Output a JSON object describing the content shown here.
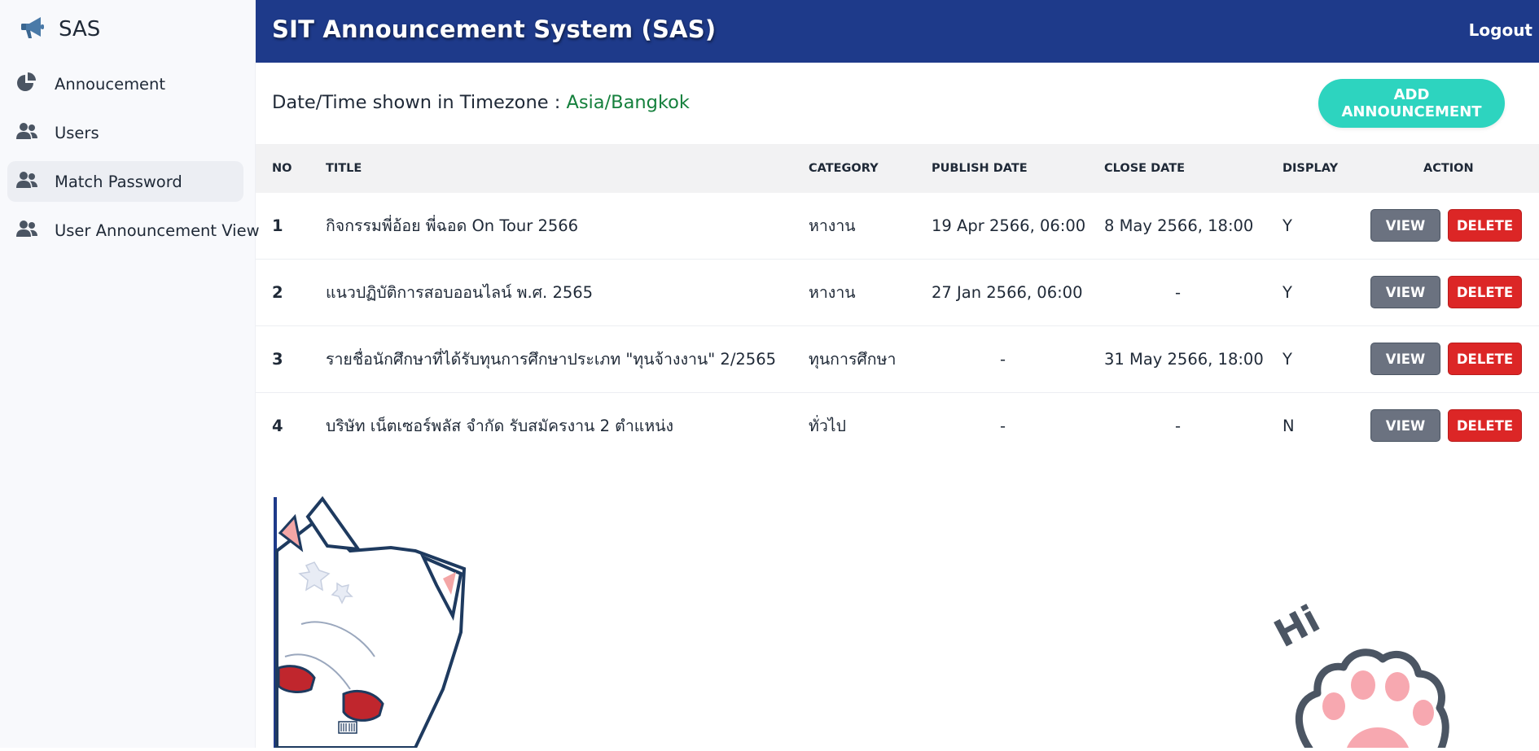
{
  "brand": {
    "name": "SAS",
    "icon": "megaphone-icon"
  },
  "sidebar": {
    "items": [
      {
        "label": "Annoucement",
        "icon": "pie-chart-icon",
        "active": false
      },
      {
        "label": "Users",
        "icon": "users-icon",
        "active": false
      },
      {
        "label": "Match Password",
        "icon": "users-icon",
        "active": true
      },
      {
        "label": "User Announcement View",
        "icon": "users-icon",
        "active": false
      }
    ]
  },
  "header": {
    "title": "SIT Announcement System (SAS)",
    "logout_label": "Logout"
  },
  "timezone": {
    "label": "Date/Time shown in Timezone : ",
    "value": "Asia/Bangkok"
  },
  "actions": {
    "add_label": "ADD ANNOUNCEMENT"
  },
  "table": {
    "headers": {
      "no": "NO",
      "title": "TITLE",
      "category": "CATEGORY",
      "publish": "PUBLISH DATE",
      "close": "CLOSE DATE",
      "display": "DISPLAY",
      "action": "ACTION"
    },
    "view_label": "VIEW",
    "delete_label": "DELETE",
    "rows": [
      {
        "no": "1",
        "title": "กิจกรรมพี่อ้อย พี่ฉอด On Tour 2566",
        "category": "หางาน",
        "publish": "19 Apr 2566, 06:00",
        "close": "8 May 2566, 18:00",
        "display": "Y"
      },
      {
        "no": "2",
        "title": "แนวปฏิบัติการสอบออนไลน์ พ.ศ. 2565",
        "category": "หางาน",
        "publish": "27 Jan 2566, 06:00",
        "close": "-",
        "display": "Y"
      },
      {
        "no": "3",
        "title": "รายชื่อนักศึกษาที่ได้รับทุนการศึกษาประเภท \"ทุนจ้างงาน\" 2/2565",
        "category": "ทุนการศึกษา",
        "publish": "-",
        "close": "31 May 2566, 18:00",
        "display": "Y"
      },
      {
        "no": "4",
        "title": "บริษัท เน็ตเซอร์พลัส จำกัด รับสมัครงาน 2 ตำแหน่ง",
        "category": "ทั่วไป",
        "publish": "-",
        "close": "-",
        "display": "N"
      }
    ]
  },
  "decorations": {
    "paw_text": "Hi"
  },
  "colors": {
    "header_bg": "#1e3a8a",
    "accent": "#2dd4bf",
    "timezone_value": "#15803d",
    "view_button": "#6b7280",
    "delete_button": "#dc2626"
  }
}
